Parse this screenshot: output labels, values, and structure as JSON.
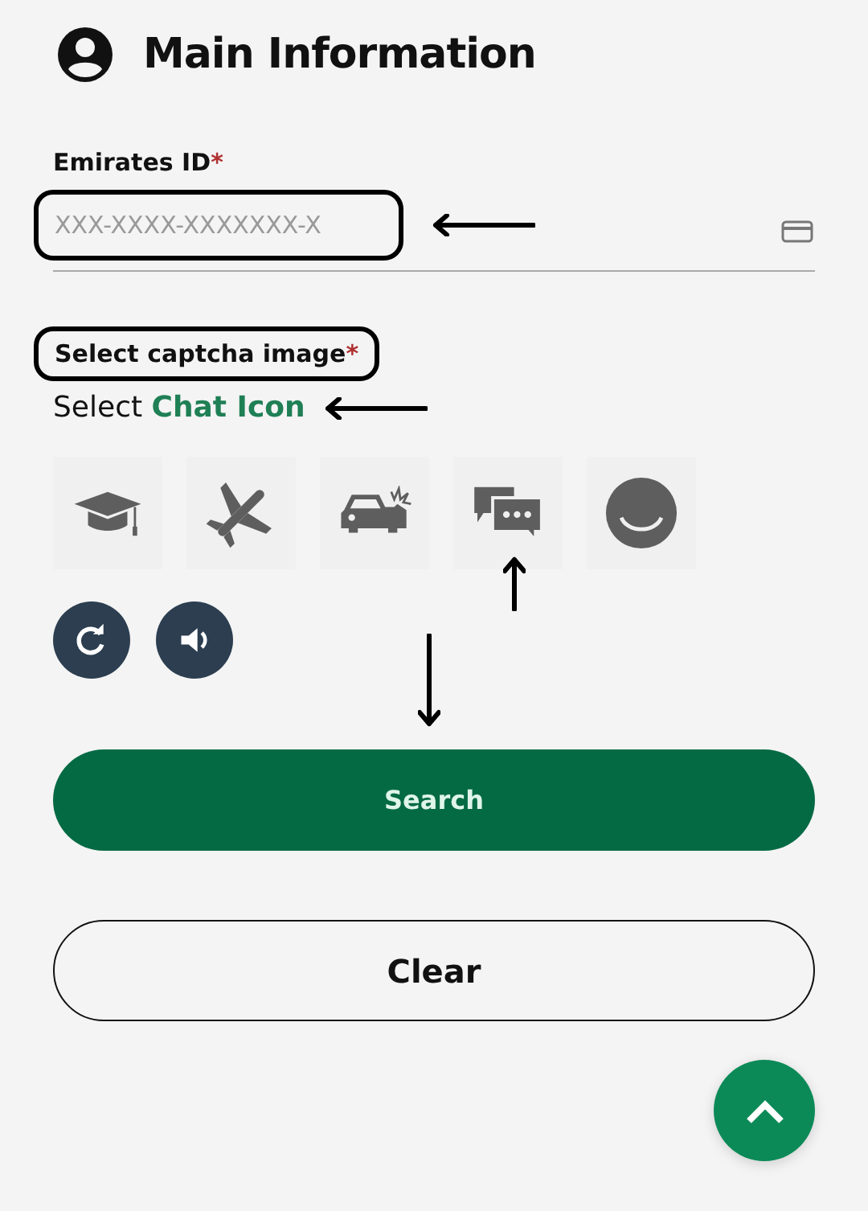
{
  "section": {
    "title": "Main Information"
  },
  "emirates_id": {
    "label": "Emirates ID",
    "required_mark": "*",
    "placeholder": "XXX-XXXX-XXXXXXX-X"
  },
  "captcha": {
    "label": "Select captcha image",
    "required_mark": "*",
    "prompt": "Select",
    "target": "Chat Icon",
    "images": [
      {
        "kind": "graduation-cap"
      },
      {
        "kind": "airplane"
      },
      {
        "kind": "car-crash"
      },
      {
        "kind": "chat"
      },
      {
        "kind": "smiley"
      }
    ]
  },
  "buttons": {
    "search": "Search",
    "clear": "Clear"
  }
}
